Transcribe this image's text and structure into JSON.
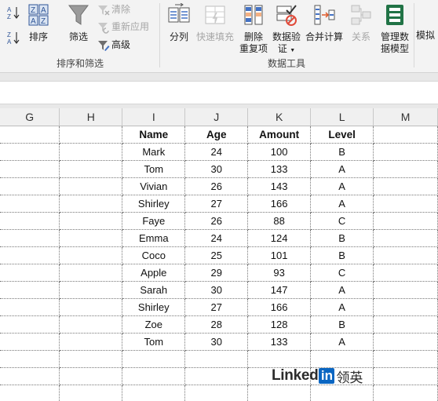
{
  "ribbon": {
    "sort_az_label": "",
    "sort": "排序",
    "filter": "筛选",
    "clear": "清除",
    "reapply": "重新应用",
    "advanced": "高级",
    "group_sort_filter": "排序和筛选",
    "text_to_columns": "分列",
    "flash_fill": "快速填充",
    "remove_duplicates_1": "删除",
    "remove_duplicates_2": "重复项",
    "data_validation_1": "数据验",
    "data_validation_2": "证",
    "consolidate": "合并计算",
    "relationships": "关系",
    "manage_model_1": "管理数",
    "manage_model_2": "据模型",
    "group_data_tools": "数据工具",
    "what_if": "模拟"
  },
  "sheet": {
    "columns": [
      "G",
      "H",
      "I",
      "J",
      "K",
      "L",
      "M"
    ],
    "headers": [
      "Name",
      "Age",
      "Amount",
      "Level"
    ],
    "rows": [
      [
        "Mark",
        "24",
        "100",
        "B"
      ],
      [
        "Tom",
        "30",
        "133",
        "A"
      ],
      [
        "Vivian",
        "26",
        "143",
        "A"
      ],
      [
        "Shirley",
        "27",
        "166",
        "A"
      ],
      [
        "Faye",
        "26",
        "88",
        "C"
      ],
      [
        "Emma",
        "24",
        "124",
        "B"
      ],
      [
        "Coco",
        "25",
        "101",
        "B"
      ],
      [
        "Apple",
        "29",
        "93",
        "C"
      ],
      [
        "Sarah",
        "30",
        "147",
        "A"
      ],
      [
        "Shirley",
        "27",
        "166",
        "A"
      ],
      [
        "Zoe",
        "28",
        "128",
        "B"
      ],
      [
        "Tom",
        "30",
        "133",
        "A"
      ]
    ]
  },
  "watermark": {
    "brand": "Linked",
    "in": "in",
    "cn": "领英"
  }
}
